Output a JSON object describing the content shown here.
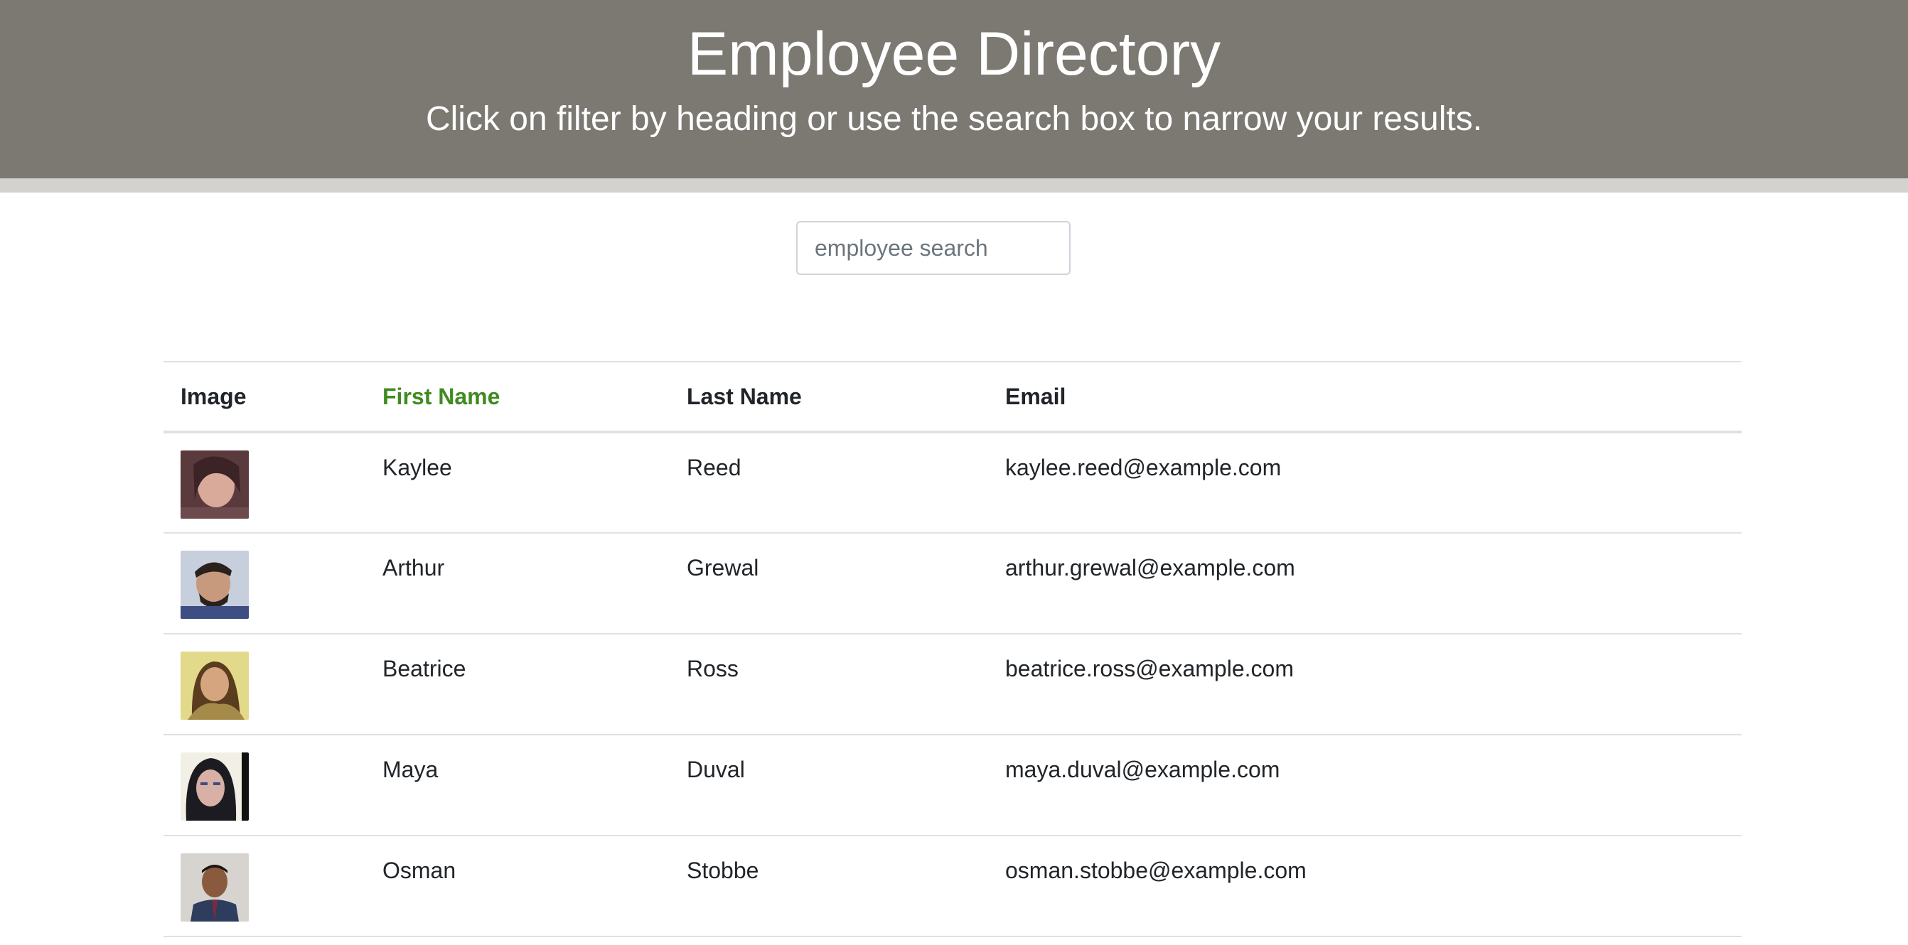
{
  "header": {
    "title": "Employee Directory",
    "subtitle": "Click on filter by heading or use the search box to narrow your results."
  },
  "search": {
    "placeholder": "employee search",
    "value": ""
  },
  "table": {
    "columns": [
      "Image",
      "First Name",
      "Last Name",
      "Email"
    ],
    "active_sort_column": "First Name",
    "rows": [
      {
        "first": "Kaylee",
        "last": "Reed",
        "email": "kaylee.reed@example.com"
      },
      {
        "first": "Arthur",
        "last": "Grewal",
        "email": "arthur.grewal@example.com"
      },
      {
        "first": "Beatrice",
        "last": "Ross",
        "email": "beatrice.ross@example.com"
      },
      {
        "first": "Maya",
        "last": "Duval",
        "email": "maya.duval@example.com"
      },
      {
        "first": "Osman",
        "last": "Stobbe",
        "email": "osman.stobbe@example.com"
      }
    ]
  },
  "colors": {
    "header_bg": "#7c7872",
    "header_border": "#d3d2cf",
    "active_heading": "#3f8b20"
  }
}
